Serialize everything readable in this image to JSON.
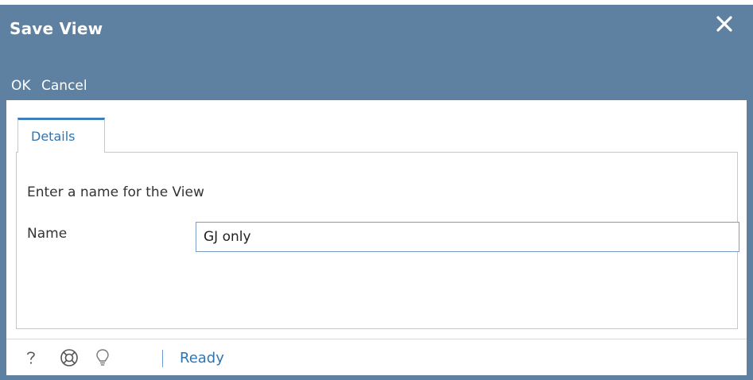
{
  "dialog": {
    "title": "Save View",
    "close_icon": "close-icon"
  },
  "toolbar": {
    "ok_label": "OK",
    "cancel_label": "Cancel"
  },
  "tabs": [
    {
      "label": "Details",
      "active": true
    }
  ],
  "form": {
    "instruction": "Enter a name for the View",
    "name_label": "Name",
    "name_value": "GJ only"
  },
  "statusbar": {
    "icons": [
      "help-icon",
      "support-icon",
      "lightbulb-icon"
    ],
    "status": "Ready"
  },
  "colors": {
    "header_bg": "#5f81a1",
    "accent": "#2e75b6",
    "input_border": "#7a9cc6"
  }
}
